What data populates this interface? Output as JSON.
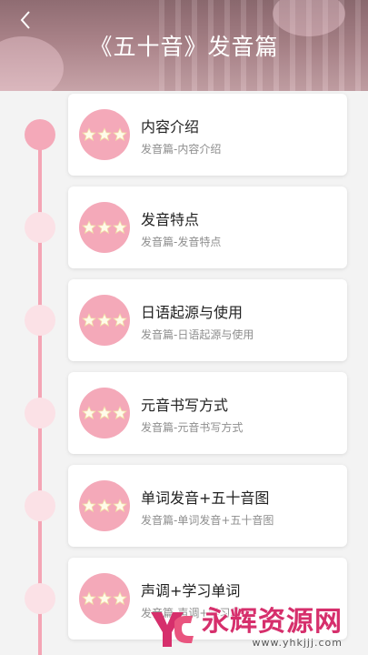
{
  "header": {
    "title": "《五十音》发音篇",
    "back_icon": "chevron-left-icon"
  },
  "colors": {
    "accent": "#f4a9b9",
    "timeline_line": "#f4a5b5",
    "dot_inactive": "#fbe1e6",
    "title_text": "#222222",
    "subtitle_text": "#8e8e8e",
    "watermark": "#d62f6c"
  },
  "lessons": [
    {
      "title": "内容介绍",
      "subtitle": "发音篇-内容介绍",
      "active": true
    },
    {
      "title": "发音特点",
      "subtitle": "发音篇-发音特点",
      "active": false
    },
    {
      "title": "日语起源与使用",
      "subtitle": "发音篇-日语起源与使用",
      "active": false
    },
    {
      "title": "元音书写方式",
      "subtitle": "发音篇-元音书写方式",
      "active": false
    },
    {
      "title": "单词发音+五十音图",
      "subtitle": "发音篇-单词发音+五十音图",
      "active": false
    },
    {
      "title": "声调+学习单词",
      "subtitle": "发音篇-声调+学习单词",
      "active": false
    }
  ],
  "watermark": {
    "text": "永辉资源网",
    "url": "www.yhkjjj.com"
  }
}
